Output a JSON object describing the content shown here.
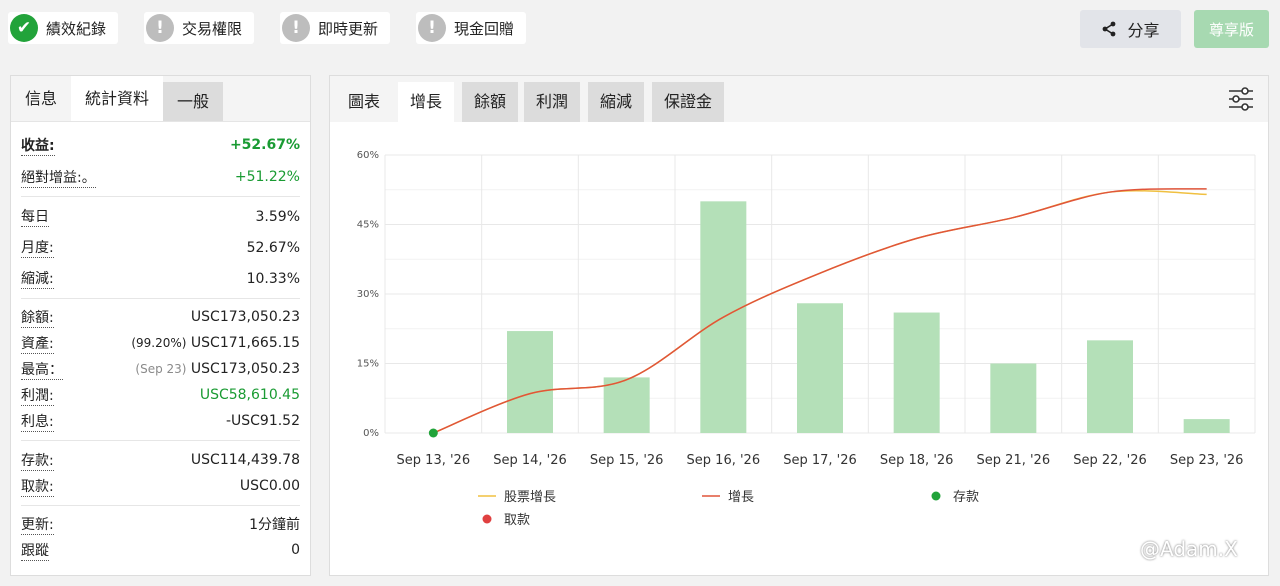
{
  "badges": [
    {
      "label": "績效紀錄",
      "icon": "check-icon",
      "symbol": "✔",
      "ok": true
    },
    {
      "label": "交易權限",
      "icon": "exclamation-icon",
      "symbol": "!",
      "ok": false
    },
    {
      "label": "即時更新",
      "icon": "exclamation-icon",
      "symbol": "!",
      "ok": false
    },
    {
      "label": "現金回贈",
      "icon": "exclamation-icon",
      "symbol": "!",
      "ok": false
    }
  ],
  "share_label": "分享",
  "pro_label": "尊享版",
  "left_tabs": [
    "信息",
    "統計資料",
    "一般"
  ],
  "stats": {
    "gain_k": "收益:",
    "gain_v": "+52.67%",
    "abs_k": "絕對增益:。",
    "abs_v": "+51.22%",
    "daily_k": "每日",
    "daily_v": "3.59%",
    "monthly_k": "月度:",
    "monthly_v": "52.67%",
    "dd_k": "縮減:",
    "dd_v": "10.33%",
    "bal_k": "餘額:",
    "bal_v": "USC173,050.23",
    "eq_k": "資產:",
    "eq_pct": "(99.20%)",
    "eq_v": "USC171,665.15",
    "high_k": "最高：",
    "high_date": "(Sep 23)",
    "high_v": "USC173,050.23",
    "profit_k": "利潤:",
    "profit_v": "USC58,610.45",
    "int_k": "利息:",
    "int_v": "-USC91.52",
    "dep_k": "存款:",
    "dep_v": "USC114,439.78",
    "wd_k": "取款:",
    "wd_v": "USC0.00",
    "upd_k": "更新:",
    "upd_v": "1分鐘前",
    "track_k": "跟蹤",
    "track_v": "0"
  },
  "right_tabs": [
    "圖表",
    "增長",
    "餘額",
    "利潤",
    "縮減",
    "保證金"
  ],
  "watermark": "@Adam.X",
  "colors": {
    "bar": "#b4e0b8",
    "growth": "#e0553a",
    "equity": "#f0c040",
    "deposit": "#22a33a",
    "withdraw": "#e04040"
  },
  "chart_data": {
    "type": "bar",
    "categories": [
      "Sep 13, '26",
      "Sep 14, '26",
      "Sep 15, '26",
      "Sep 16, '26",
      "Sep 17, '26",
      "Sep 18, '26",
      "Sep 21, '26",
      "Sep 22, '26",
      "Sep 23, '26"
    ],
    "values": [
      0,
      22,
      12,
      50,
      28,
      26,
      15,
      20,
      3
    ],
    "series": [
      {
        "name": "股票增長",
        "values": [
          0,
          8.5,
          11.5,
          25,
          34.5,
          42,
          46.5,
          52,
          51.5
        ]
      },
      {
        "name": "增長",
        "values": [
          0,
          8.5,
          11.5,
          25,
          34.5,
          42,
          46.5,
          52,
          52.7
        ]
      }
    ],
    "deposit_point": {
      "category": "Sep 13, '26",
      "value": 0
    },
    "legend": [
      "股票增長",
      "增長",
      "存款",
      "取款"
    ],
    "yticks": [
      "0%",
      "15%",
      "30%",
      "45%",
      "60%"
    ],
    "ylim": [
      0,
      60
    ],
    "grid": true,
    "legend_position": "bottom"
  }
}
